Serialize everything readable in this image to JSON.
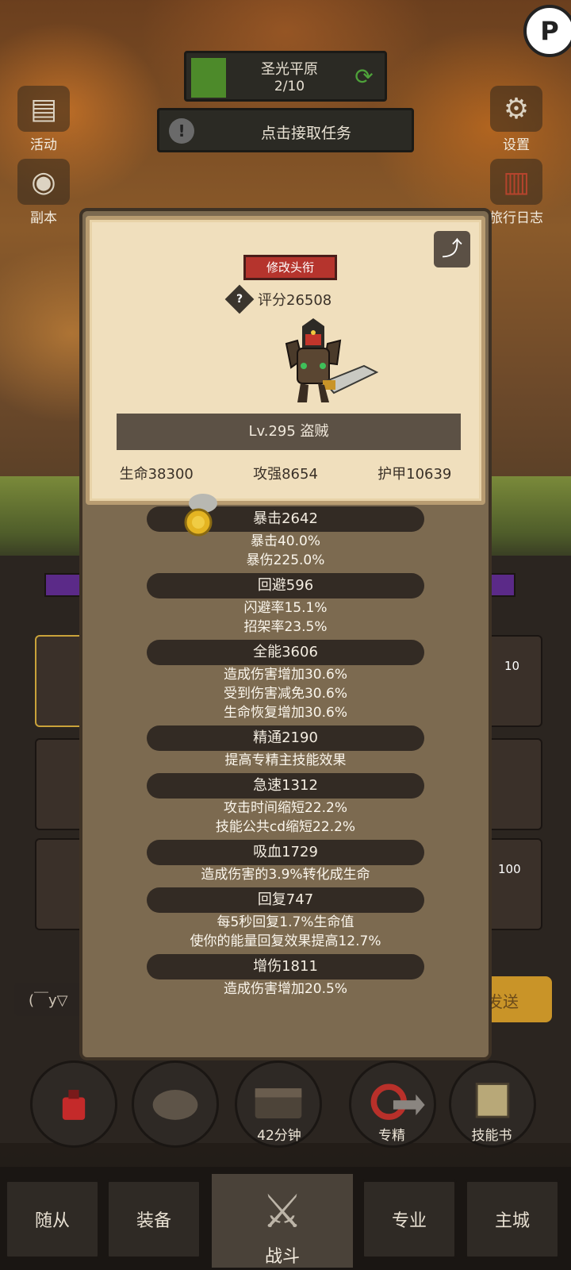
{
  "map": {
    "name": "圣光平原",
    "progress": "2/10"
  },
  "task": {
    "label": "点击接取任务"
  },
  "side_left": [
    {
      "label": "活动",
      "icon": "scroll-icon"
    },
    {
      "label": "副本",
      "icon": "portal-icon"
    }
  ],
  "side_right": [
    {
      "label": "设置",
      "icon": "gear-icon"
    },
    {
      "label": "旅行日志",
      "icon": "journal-icon"
    }
  ],
  "character": {
    "title_button": "修改头衔",
    "score": "评分26508",
    "level_class": "Lv.295 盗贼",
    "hp": "生命38300",
    "attack": "攻强8654",
    "armor": "护甲10639"
  },
  "attributes": [
    {
      "name": "暴击2642",
      "details": [
        "暴击40.0%",
        "暴伤225.0%"
      ]
    },
    {
      "name": "回避596",
      "details": [
        "闪避率15.1%",
        "招架率23.5%"
      ]
    },
    {
      "name": "全能3606",
      "details": [
        "造成伤害增加30.6%",
        "受到伤害减免30.6%",
        "生命恢复增加30.6%"
      ]
    },
    {
      "name": "精通2190",
      "details": [
        "提高专精主技能效果"
      ]
    },
    {
      "name": "急速1312",
      "details": [
        "攻击时间缩短22.2%",
        "技能公共cd缩短22.2%"
      ]
    },
    {
      "name": "吸血1729",
      "details": [
        "造成伤害的3.9%转化成生命"
      ]
    },
    {
      "name": "回复747",
      "details": [
        "每5秒回复1.7%生命值",
        "使你的能量回复效果提高12.7%"
      ]
    },
    {
      "name": "增伤1811",
      "details": [
        "造成伤害增加20.5%"
      ]
    }
  ],
  "background": {
    "badge_1": "10",
    "badge_2": "100",
    "input_text": "(￣y▽",
    "send_text": "发送"
  },
  "bottom_buttons": {
    "timer": "42分钟",
    "specialization": "专精",
    "skill_book": "技能书"
  },
  "tabs": {
    "followers": "随从",
    "equipment": "装备",
    "battle": "战斗",
    "profession": "专业",
    "main_city": "主城"
  },
  "colors": {
    "panel": "#7c6a50",
    "card": "#f0dfbd",
    "title_button": "#b5342d",
    "attr_head": "#332b24"
  }
}
